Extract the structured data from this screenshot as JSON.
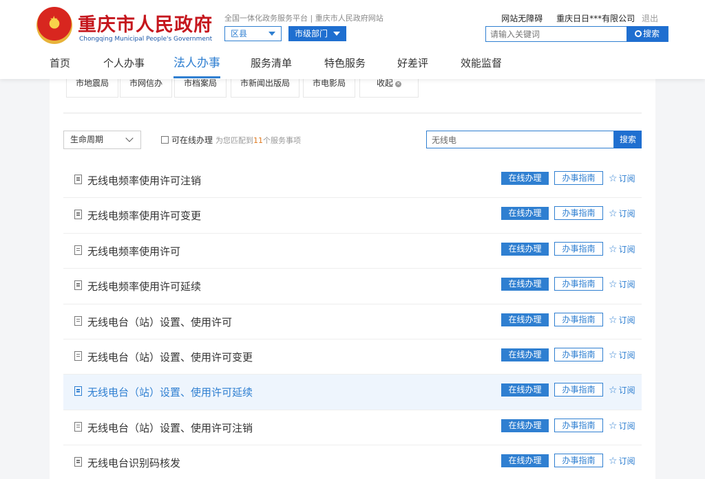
{
  "header": {
    "site_title": "重庆市人民政府",
    "site_subtitle": "Chongqing Municipal People's Government",
    "tagline": "全国一体化政务服务平台 | 重庆市人民政府网站",
    "district_select": "区县",
    "city_select": "市级部门",
    "accessibility_link": "网站无障碍",
    "company_name": "重庆日日***有限公司",
    "logout": "退出",
    "search_placeholder": "请输入关键词",
    "search_button": "搜索"
  },
  "nav": {
    "items": [
      "首页",
      "个人办事",
      "法人办事",
      "服务清单",
      "特色服务",
      "好差评",
      "效能监督"
    ],
    "active": "法人办事"
  },
  "chips": {
    "items": [
      "市地震局",
      "市网信办",
      "市档案局",
      "市新闻出版局",
      "市电影局"
    ],
    "collapse": "收起"
  },
  "filter": {
    "lifecycle": "生命周期",
    "online_only": "可在线办理",
    "match_prefix": "为您匹配到",
    "match_count": "11",
    "match_suffix": "个服务事项",
    "search_value": "无线电",
    "search_button": "搜索"
  },
  "list": {
    "online_label": "在线办理",
    "guide_label": "办事指南",
    "subscribe_label": "订阅",
    "items": [
      "无线电频率使用许可注销",
      "无线电频率使用许可变更",
      "无线电频率使用许可",
      "无线电频率使用许可延续",
      "无线电台（站）设置、使用许可",
      "无线电台（站）设置、使用许可变更",
      "无线电台（站）设置、使用许可延续",
      "无线电台（站）设置、使用许可注销",
      "无线电台识别码核发"
    ],
    "highlighted_index": 6
  },
  "colors": {
    "brand_red": "#c5161d",
    "accent_blue": "#2f7fd1",
    "match_orange": "#e07a1f"
  }
}
